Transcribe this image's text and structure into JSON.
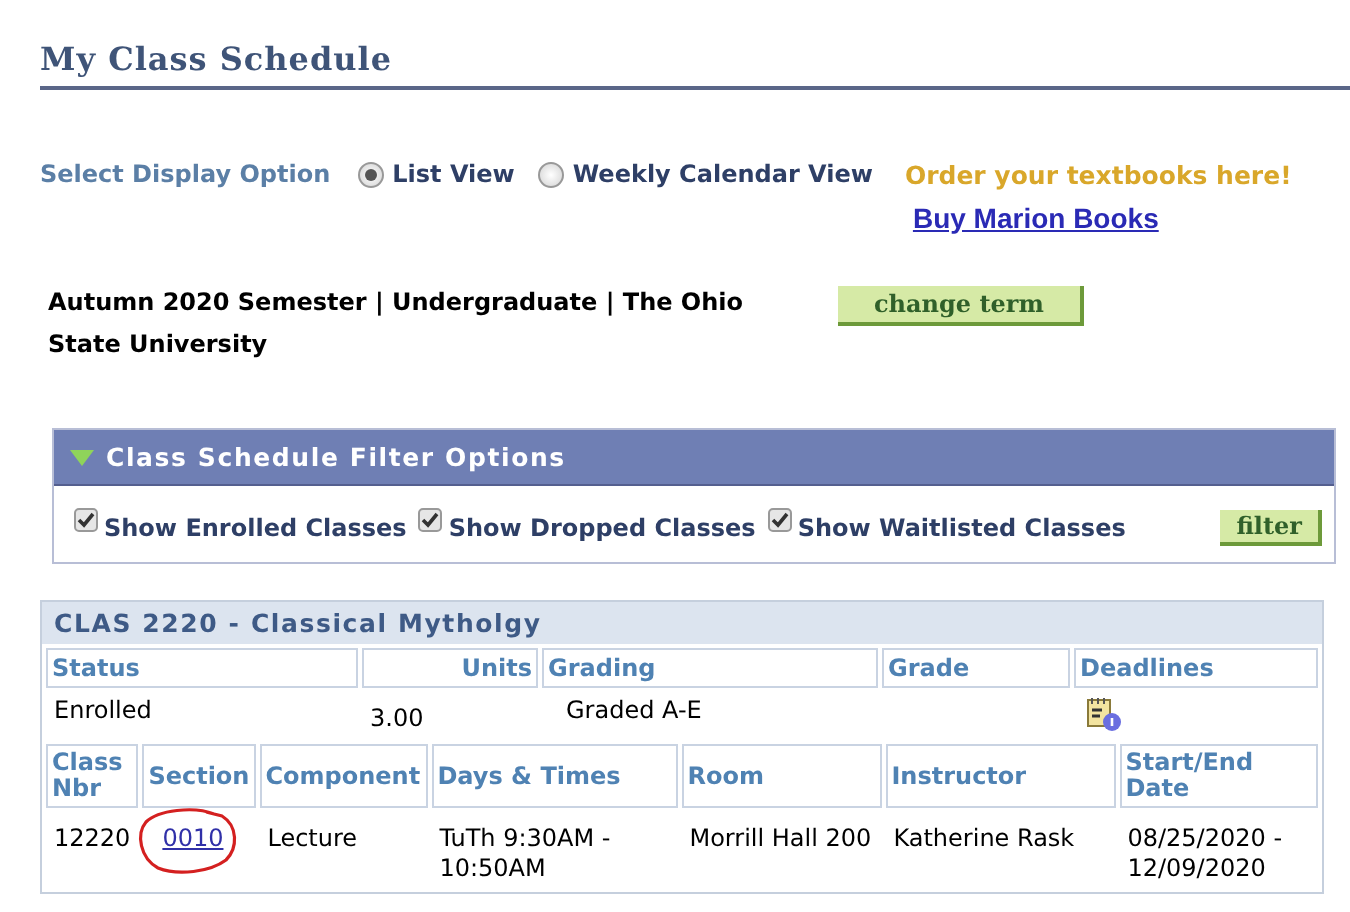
{
  "page": {
    "title": "My Class Schedule"
  },
  "display_option": {
    "label": "Select Display Option",
    "options": [
      {
        "label": "List View",
        "selected": true
      },
      {
        "label": "Weekly Calendar View",
        "selected": false
      }
    ]
  },
  "textbooks": {
    "promo": "Order your textbooks here!",
    "link": "Buy Marion Books"
  },
  "term": {
    "text": "Autumn 2020 Semester | Undergraduate | The Ohio State University",
    "button": "change term"
  },
  "filter": {
    "title": "Class Schedule Filter Options",
    "expanded": true,
    "options": [
      {
        "label": "Show Enrolled Classes",
        "checked": true
      },
      {
        "label": "Show Dropped Classes",
        "checked": true
      },
      {
        "label": "Show Waitlisted Classes",
        "checked": true
      }
    ],
    "button": "filter"
  },
  "classes": [
    {
      "title": "CLAS 2220 - Classical Mytholgy",
      "status_columns": [
        "Status",
        "Units",
        "Grading",
        "Grade",
        "Deadlines"
      ],
      "status_row": {
        "status": "Enrolled",
        "units": "3.00",
        "grading": "Graded A-E"
      },
      "section_columns": [
        "Class Nbr",
        "Section",
        "Component",
        "Days & Times",
        "Room",
        "Instructor",
        "Start/End Date"
      ],
      "sections": [
        {
          "class_nbr": "12220",
          "section": "0010",
          "component": "Lecture",
          "days_times": "TuTh 9:30AM - 10:50AM",
          "room": "Morrill Hall 200",
          "instructor": "Katherine Rask",
          "dates": "08/25/2020 - 12/09/2020"
        }
      ]
    }
  ]
}
